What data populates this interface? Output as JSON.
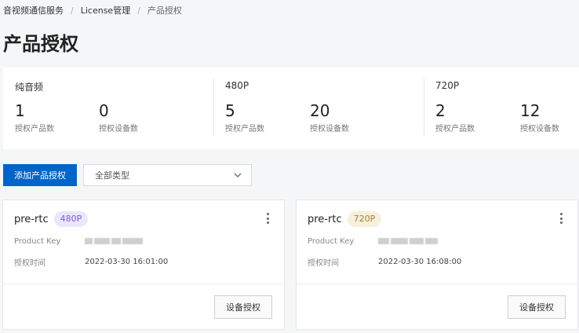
{
  "breadcrumb": {
    "items": [
      "音视频通信服务",
      "License管理",
      "产品授权"
    ],
    "separator": "/"
  },
  "page": {
    "title": "产品授权"
  },
  "stats": [
    {
      "title": "纯音频",
      "items": [
        {
          "value": "1",
          "label": "授权产品数"
        },
        {
          "value": "0",
          "label": "授权设备数"
        }
      ]
    },
    {
      "title": "480P",
      "items": [
        {
          "value": "5",
          "label": "授权产品数"
        },
        {
          "value": "20",
          "label": "授权设备数"
        }
      ]
    },
    {
      "title": "720P",
      "items": [
        {
          "value": "2",
          "label": "授权产品数"
        },
        {
          "value": "12",
          "label": "授权设备数"
        }
      ]
    }
  ],
  "toolbar": {
    "add_label": "添加产品授权",
    "type_select_value": "全部类型"
  },
  "cards": [
    {
      "name": "pre-rtc",
      "badge": "480P",
      "badge_color": "#ece6fb",
      "product_key_label": "Product Key",
      "time_label": "授权时间",
      "time_value": "2022-03-30 16:01:00",
      "button_label": "设备授权"
    },
    {
      "name": "pre-rtc",
      "badge": "720P",
      "badge_color": "#f6f0dc",
      "product_key_label": "Product Key",
      "time_label": "授权时间",
      "time_value": "2022-03-30 16:08:00",
      "button_label": "设备授权"
    }
  ],
  "colors": {
    "primary": "#0064c8",
    "page_bg": "#f5f6f8"
  },
  "icons": {
    "select": "chevron-down-icon",
    "card_menu": "more-vertical-icon"
  }
}
